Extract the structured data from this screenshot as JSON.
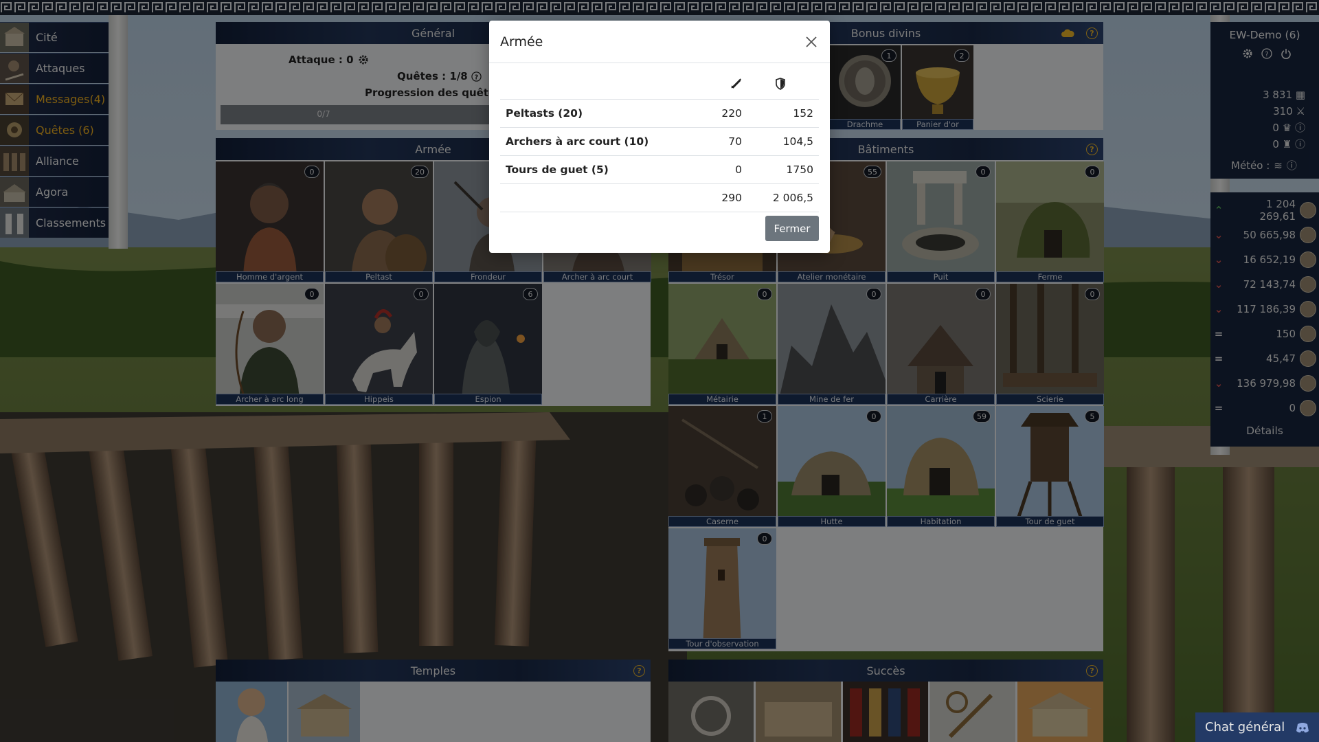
{
  "nav": {
    "items": [
      {
        "label": "Cité",
        "icon": "city-icon"
      },
      {
        "label": "Attaques",
        "icon": "attack-icon"
      },
      {
        "label": "Messages(4)",
        "icon": "messages-icon"
      },
      {
        "label": "Quêtes (6)",
        "icon": "quests-icon"
      },
      {
        "label": "Alliance",
        "icon": "alliance-icon"
      },
      {
        "label": "Agora",
        "icon": "agora-icon"
      },
      {
        "label": "Classements",
        "icon": "rankings-icon"
      }
    ]
  },
  "general": {
    "title": "Général",
    "attack_label": "Attaque : 0",
    "quests_label": "Quêtes : 1/8",
    "progress_label": "Progression des quêtes :",
    "progress_text": "0/7",
    "progress_value": 0
  },
  "divine": {
    "title": "Bonus divins",
    "items": [
      {
        "label": "Drachme",
        "count": "1"
      },
      {
        "label": "Panier d'or",
        "count": "2"
      }
    ]
  },
  "army": {
    "title": "Armée",
    "units": [
      {
        "label": "Homme d'argent",
        "count": "0"
      },
      {
        "label": "Peltast",
        "count": "20"
      },
      {
        "label": "Frondeur",
        "count": ""
      },
      {
        "label": "Archer à arc court",
        "count": ""
      },
      {
        "label": "Archer à arc long",
        "count": "0"
      },
      {
        "label": "Hippeis",
        "count": "0"
      },
      {
        "label": "Espion",
        "count": "6"
      }
    ]
  },
  "buildings": {
    "title": "Bâtiments",
    "items": [
      {
        "label": "Trésor",
        "count": ""
      },
      {
        "label": "Atelier monétaire",
        "count": "55"
      },
      {
        "label": "Puit",
        "count": "0"
      },
      {
        "label": "Ferme",
        "count": "0"
      },
      {
        "label": "Métairie",
        "count": "0"
      },
      {
        "label": "Mine de fer",
        "count": "0"
      },
      {
        "label": "Carrière",
        "count": "0"
      },
      {
        "label": "Scierie",
        "count": "0"
      },
      {
        "label": "Caserne",
        "count": "1"
      },
      {
        "label": "Hutte",
        "count": "0"
      },
      {
        "label": "Habitation",
        "count": "59"
      },
      {
        "label": "Tour de guet",
        "count": "5"
      },
      {
        "label": "Tour d'observation",
        "count": "0"
      }
    ]
  },
  "temples": {
    "title": "Temples"
  },
  "success": {
    "title": "Succès"
  },
  "player": {
    "name": "EW-Demo (6)",
    "stats": [
      {
        "value": "3 831",
        "icon": "grid-icon"
      },
      {
        "value": "310",
        "icon": "sword-icon"
      },
      {
        "value": "0",
        "icon": "crown-icon"
      },
      {
        "value": "0",
        "icon": "trophy-icon"
      }
    ],
    "weather_label": "Météo :",
    "resources": [
      {
        "trend": "up",
        "value": "1 204 269,61",
        "icon": "coin-icon"
      },
      {
        "trend": "down",
        "value": "50 665,98",
        "icon": "iron-icon"
      },
      {
        "trend": "down",
        "value": "16 652,19",
        "icon": "water-icon"
      },
      {
        "trend": "down",
        "value": "72 143,74",
        "icon": "wood-icon"
      },
      {
        "trend": "down",
        "value": "117 186,39",
        "icon": "stone-icon"
      },
      {
        "trend": "equal",
        "value": "150",
        "icon": "population-icon"
      },
      {
        "trend": "equal",
        "value": "45,47",
        "icon": "marble-icon"
      },
      {
        "trend": "down",
        "value": "136 979,98",
        "icon": "grain-icon"
      },
      {
        "trend": "equal",
        "value": "0",
        "icon": "favor-icon"
      }
    ],
    "details_label": "Détails"
  },
  "chat": {
    "label": "Chat général"
  },
  "modal": {
    "title": "Armée",
    "rows": [
      {
        "name": "Peltasts (20)",
        "attack": "220",
        "defense": "152"
      },
      {
        "name": "Archers à arc court (10)",
        "attack": "70",
        "defense": "104,5"
      },
      {
        "name": "Tours de guet (5)",
        "attack": "0",
        "defense": "1750"
      }
    ],
    "total_attack": "290",
    "total_defense": "2 006,5",
    "close_label": "Fermer"
  },
  "colors": {
    "nav_bg": "#1a2741",
    "accent_gold": "#f3b320",
    "header_bg": "#1c2d4d",
    "button_gray": "#6c757d",
    "trend_down": "#d9534f",
    "trend_up": "#5cb85c"
  }
}
